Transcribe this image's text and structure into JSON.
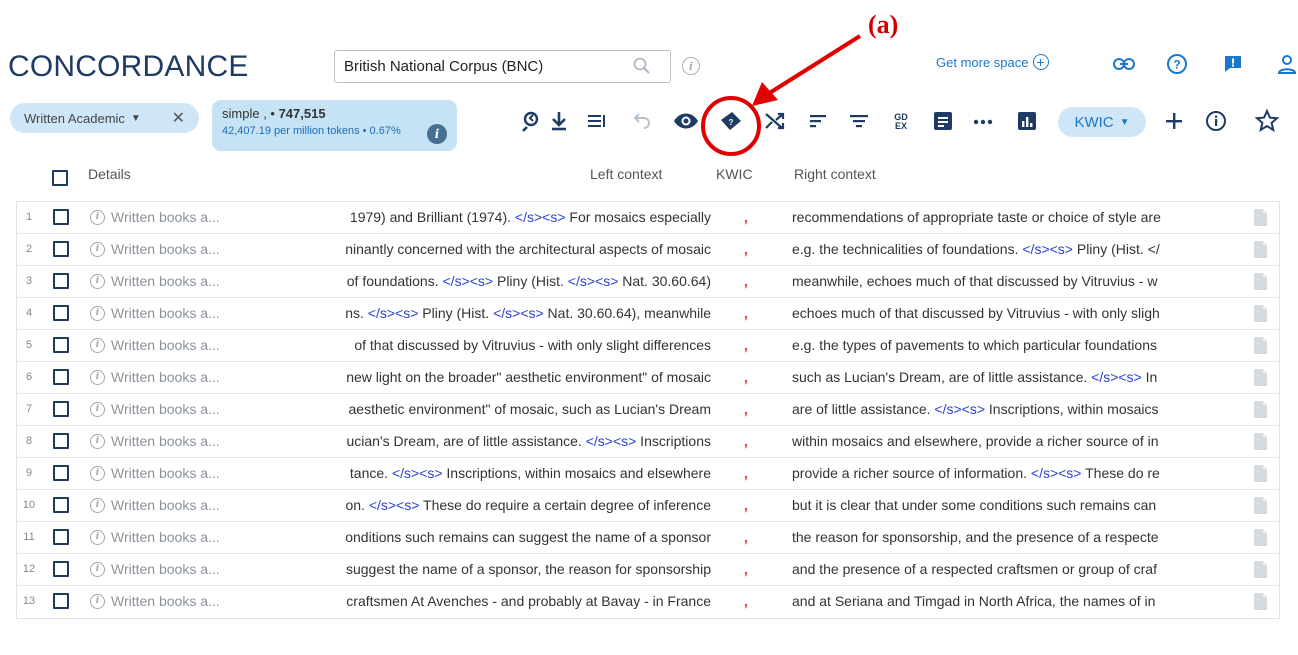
{
  "header": {
    "title": "CONCORDANCE",
    "corpus_value": "British National Corpus (BNC)",
    "get_more_space": "Get more space",
    "annotation_label": "(a)"
  },
  "filter_chip": {
    "label": "Written Academic"
  },
  "result": {
    "query": "simple",
    "count": "747,515",
    "stats": "42,407.19 per million tokens • 0.67%"
  },
  "toolbar": {
    "view_mode": "KWIC",
    "icons": [
      "reduce-icon",
      "download-icon",
      "lines-icon",
      "undo-icon",
      "eye-icon",
      "gdex-ticket-icon",
      "shuffle-icon",
      "sort-icon",
      "filter-icon",
      "gdex-icon",
      "text-type-icon",
      "more-icon",
      "frequency-icon",
      "kwic-dropdown",
      "add-icon",
      "info-icon",
      "star-icon"
    ]
  },
  "columns": {
    "details": "Details",
    "left": "Left context",
    "kwic": "KWIC",
    "right": "Right context"
  },
  "colors": {
    "accent": "#1b78c8",
    "title": "#1f3b63",
    "kwic": "#e23b3b",
    "tag": "#2a3fd6",
    "annotation": "#e00000"
  },
  "rows": [
    {
      "num": "1",
      "details": "Written books a...",
      "left": "1979) and Brilliant (1974). </s><s> For mosaics especially",
      "kwic": ",",
      "right": "recommendations of appropriate taste or choice of style are"
    },
    {
      "num": "2",
      "details": "Written books a...",
      "left": "ninantly concerned with the architectural aspects of mosaic",
      "kwic": ",",
      "right": "e.g. the technicalities of foundations. </s><s> Pliny (Hist. </"
    },
    {
      "num": "3",
      "details": "Written books a...",
      "left": "of foundations. </s><s> Pliny (Hist. </s><s> Nat. 30.60.64)",
      "kwic": ",",
      "right": "meanwhile, echoes much of that discussed by Vitruvius - w"
    },
    {
      "num": "4",
      "details": "Written books a...",
      "left": "ns. </s><s> Pliny (Hist. </s><s> Nat. 30.60.64), meanwhile",
      "kwic": ",",
      "right": "echoes much of that discussed by Vitruvius - with only sligh"
    },
    {
      "num": "5",
      "details": "Written books a...",
      "left": "of that discussed by Vitruvius - with only slight differences",
      "kwic": ",",
      "right": "e.g. the types of pavements to which particular foundations"
    },
    {
      "num": "6",
      "details": "Written books a...",
      "left": "new light on the broader\" aesthetic environment\" of mosaic",
      "kwic": ",",
      "right": "such as Lucian's Dream, are of little assistance. </s><s> In"
    },
    {
      "num": "7",
      "details": "Written books a...",
      "left": "aesthetic environment\" of mosaic, such as Lucian's Dream",
      "kwic": ",",
      "right": "are of little assistance. </s><s> Inscriptions, within mosaics"
    },
    {
      "num": "8",
      "details": "Written books a...",
      "left": "ucian's Dream, are of little assistance. </s><s> Inscriptions",
      "kwic": ",",
      "right": "within mosaics and elsewhere, provide a richer source of in"
    },
    {
      "num": "9",
      "details": "Written books a...",
      "left": "tance. </s><s> Inscriptions, within mosaics and elsewhere",
      "kwic": ",",
      "right": "provide a richer source of information. </s><s> These do re"
    },
    {
      "num": "10",
      "details": "Written books a...",
      "left": "on. </s><s> These do require a certain degree of inference",
      "kwic": ",",
      "right": "but it is clear that under some conditions such remains can"
    },
    {
      "num": "11",
      "details": "Written books a...",
      "left": "onditions such remains can suggest the name of a sponsor",
      "kwic": ",",
      "right": "the reason for sponsorship, and the presence of a respecte"
    },
    {
      "num": "12",
      "details": "Written books a...",
      "left": "suggest the name of a sponsor, the reason for sponsorship",
      "kwic": ",",
      "right": "and the presence of a respected craftsmen or group of craf"
    },
    {
      "num": "13",
      "details": "Written books a...",
      "left": "craftsmen At Avenches - and probably at Bavay - in France",
      "kwic": ",",
      "right": "and at Seriana and Timgad in North Africa, the names of in"
    }
  ]
}
